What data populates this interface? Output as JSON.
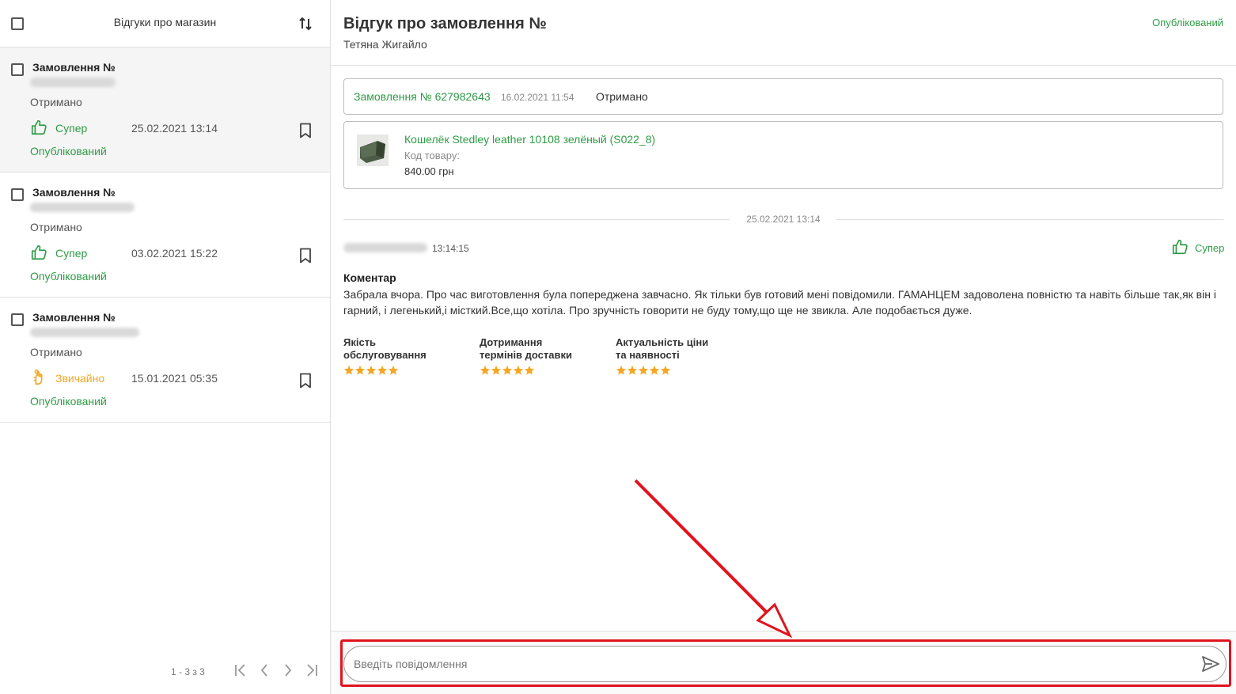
{
  "left_panel": {
    "select_all": "",
    "title": "Відгуки про магазин",
    "items": [
      {
        "order_label": "Замовлення №",
        "status": "Отримано",
        "rating": "Супер",
        "rating_type": "super",
        "date": "25.02.2021 13:14",
        "published": "Опублікований",
        "active": true
      },
      {
        "order_label": "Замовлення №",
        "status": "Отримано",
        "rating": "Супер",
        "rating_type": "super",
        "date": "03.02.2021 15:22",
        "published": "Опублікований",
        "active": false
      },
      {
        "order_label": "Замовлення №",
        "status": "Отримано",
        "rating": "Звичайно",
        "rating_type": "normal",
        "date": "15.01.2021 05:35",
        "published": "Опублікований",
        "active": false
      }
    ],
    "pager": {
      "range": "1 - 3 з 3"
    }
  },
  "detail": {
    "title": "Відгук про замовлення №",
    "author": "Тетяна Жигайло",
    "status": "Опублікований",
    "order": {
      "link": "Замовлення № 627982643",
      "date": "16.02.2021 11:54",
      "status": "Отримано"
    },
    "product": {
      "name": "Кошелёк Stedley leather 10108 зелёный (S022_8)",
      "code_label": "Код товару:",
      "price": "840.00 грн"
    },
    "review_date": "25.02.2021 13:14",
    "review_time": "13:14:15",
    "rating": "Супер",
    "comment_label": "Коментар",
    "comment": "Забрала вчора. Про час виготовлення була попереджена завчасно. Як тільки був готовий мені повідомили. ГАМАНЦЕМ задоволена повністю та навіть більше так,як він і гарний, і легенький,і місткий.Все,що хотіла. Про зручність говорити не буду тому,що ще не звикла. Але подобається дуже.",
    "criteria": [
      {
        "line1": "Якість",
        "line2": "обслуговування",
        "stars": 5
      },
      {
        "line1": "Дотримання",
        "line2": "термінів доставки",
        "stars": 5
      },
      {
        "line1": "Актуальність ціни",
        "line2": "та наявності",
        "stars": 5
      }
    ]
  },
  "message": {
    "placeholder": "Введіть повідомлення"
  },
  "colors": {
    "accent_green": "#2e9b45",
    "star_orange": "#f5a623",
    "highlight_red": "#e0141e"
  }
}
